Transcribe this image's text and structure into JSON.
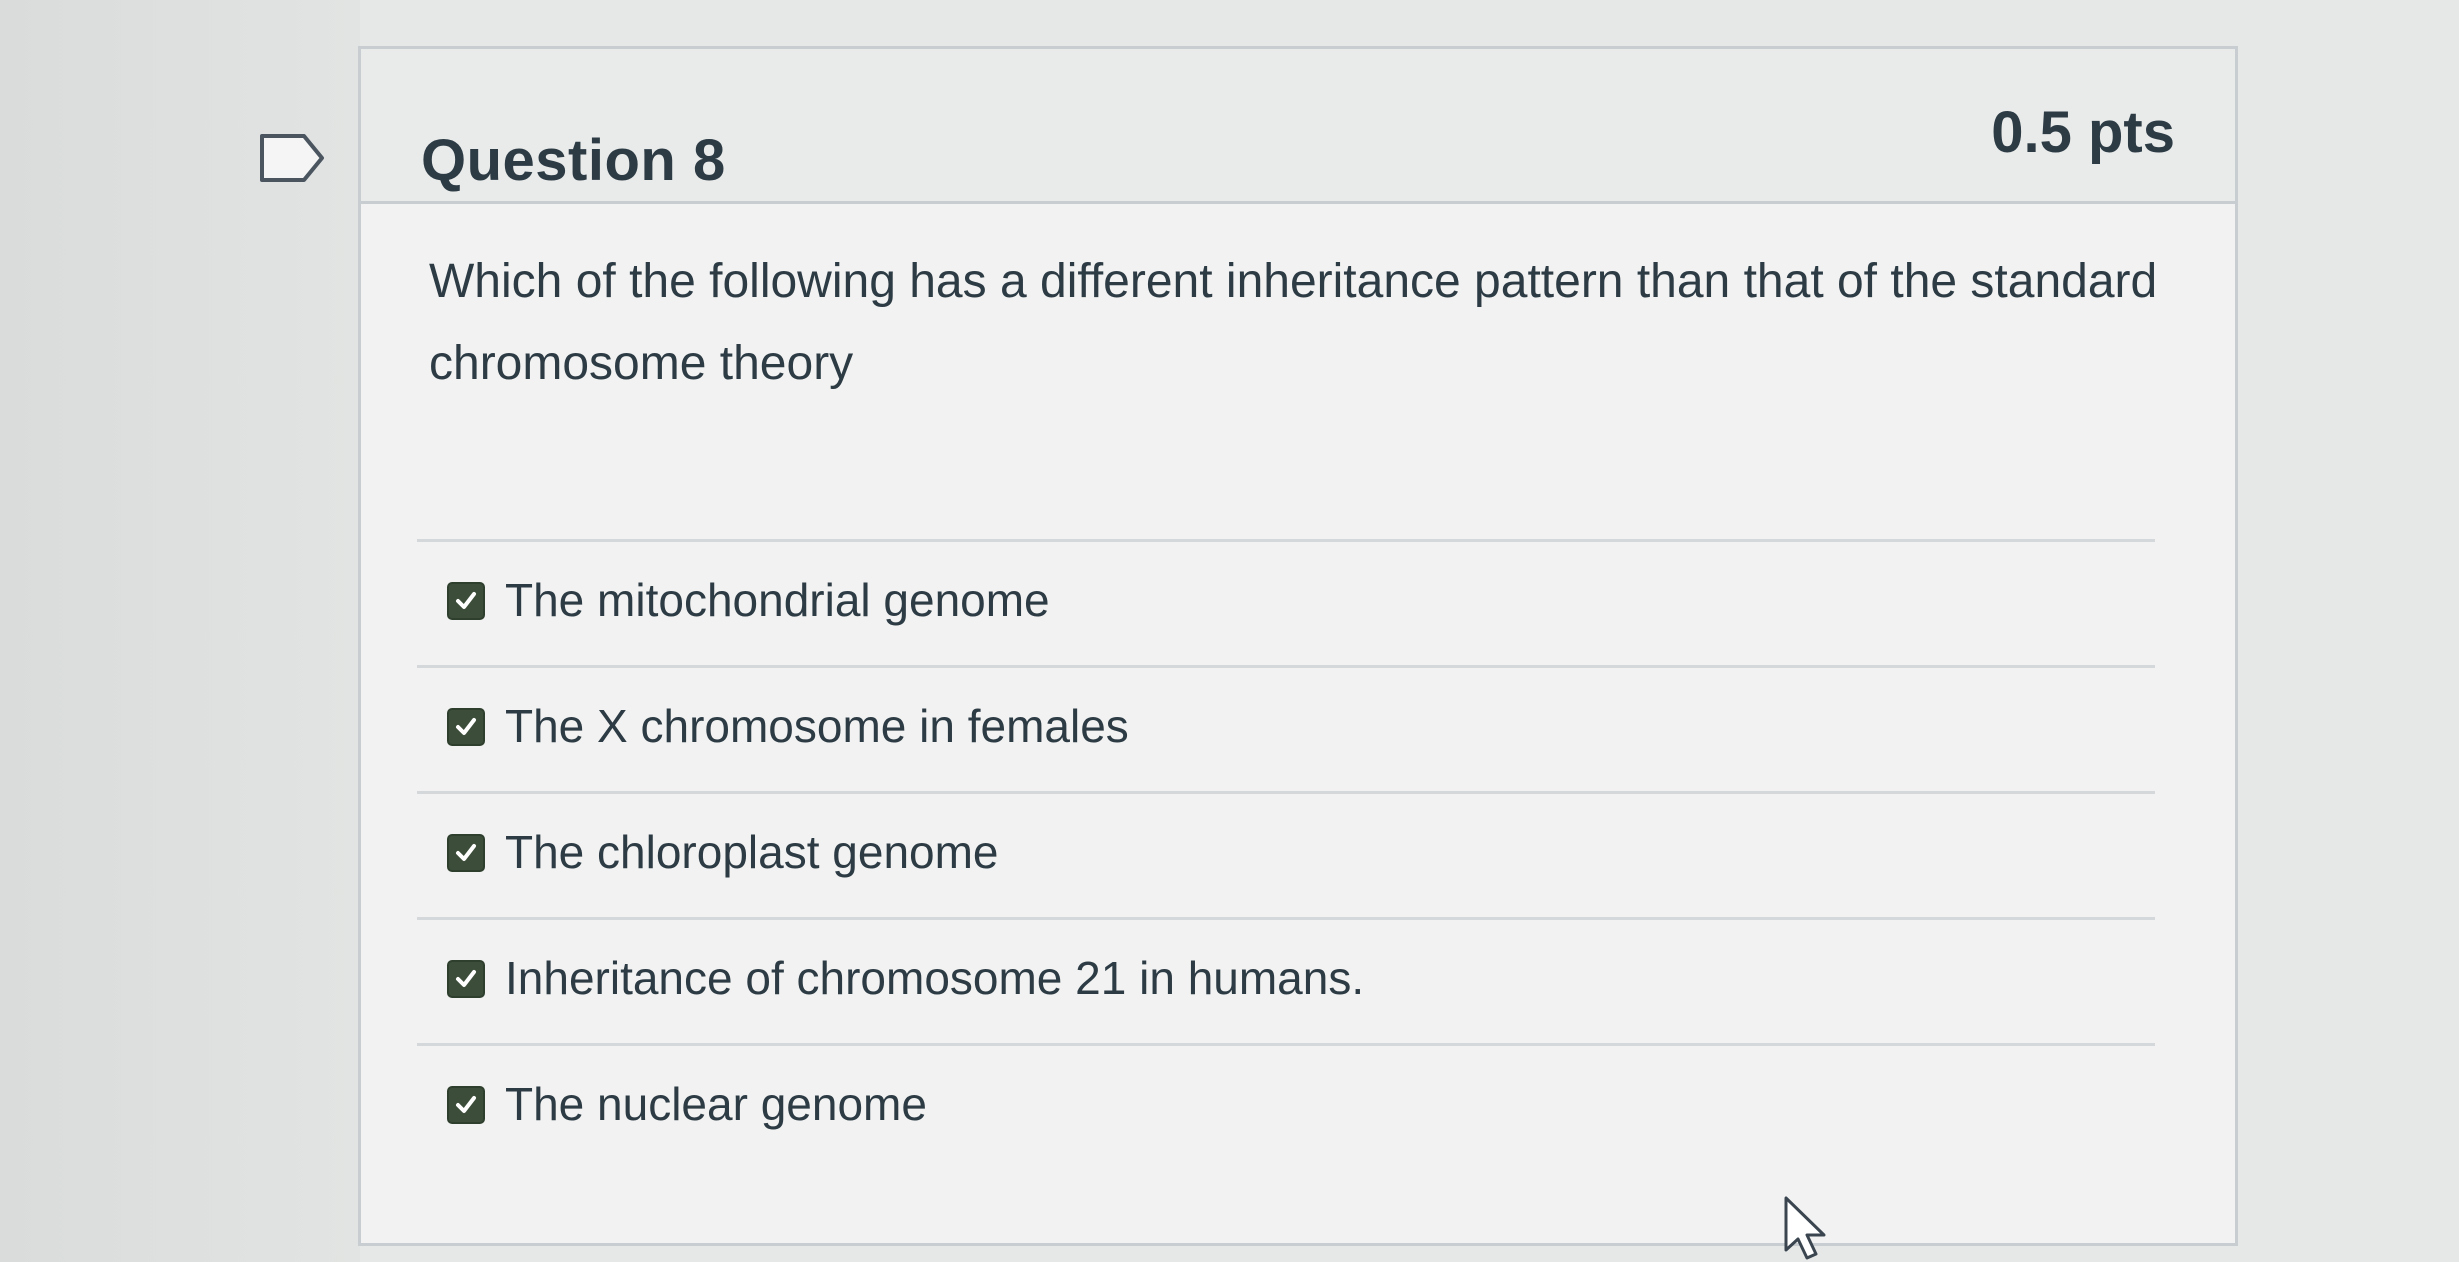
{
  "question": {
    "title": "Question 8",
    "points": "0.5 pts",
    "text": "Which of the following has a different inheritance pattern than that of the standard chromosome theory"
  },
  "answers": [
    {
      "label": "The mitochondrial genome",
      "checked": true
    },
    {
      "label": "The X chromosome in females",
      "checked": true
    },
    {
      "label": "The chloroplast genome",
      "checked": true
    },
    {
      "label": "Inheritance of chromosome 21 in humans.",
      "checked": true
    },
    {
      "label": "The nuclear genome",
      "checked": true
    }
  ],
  "icons": {
    "flag": "flag-icon",
    "checkbox": "checkmark-icon",
    "cursor": "mouse-pointer-icon"
  },
  "colors": {
    "text": "#2d3b45",
    "checkbox_fill": "#3c4e3a",
    "border": "#c7cdd1"
  }
}
